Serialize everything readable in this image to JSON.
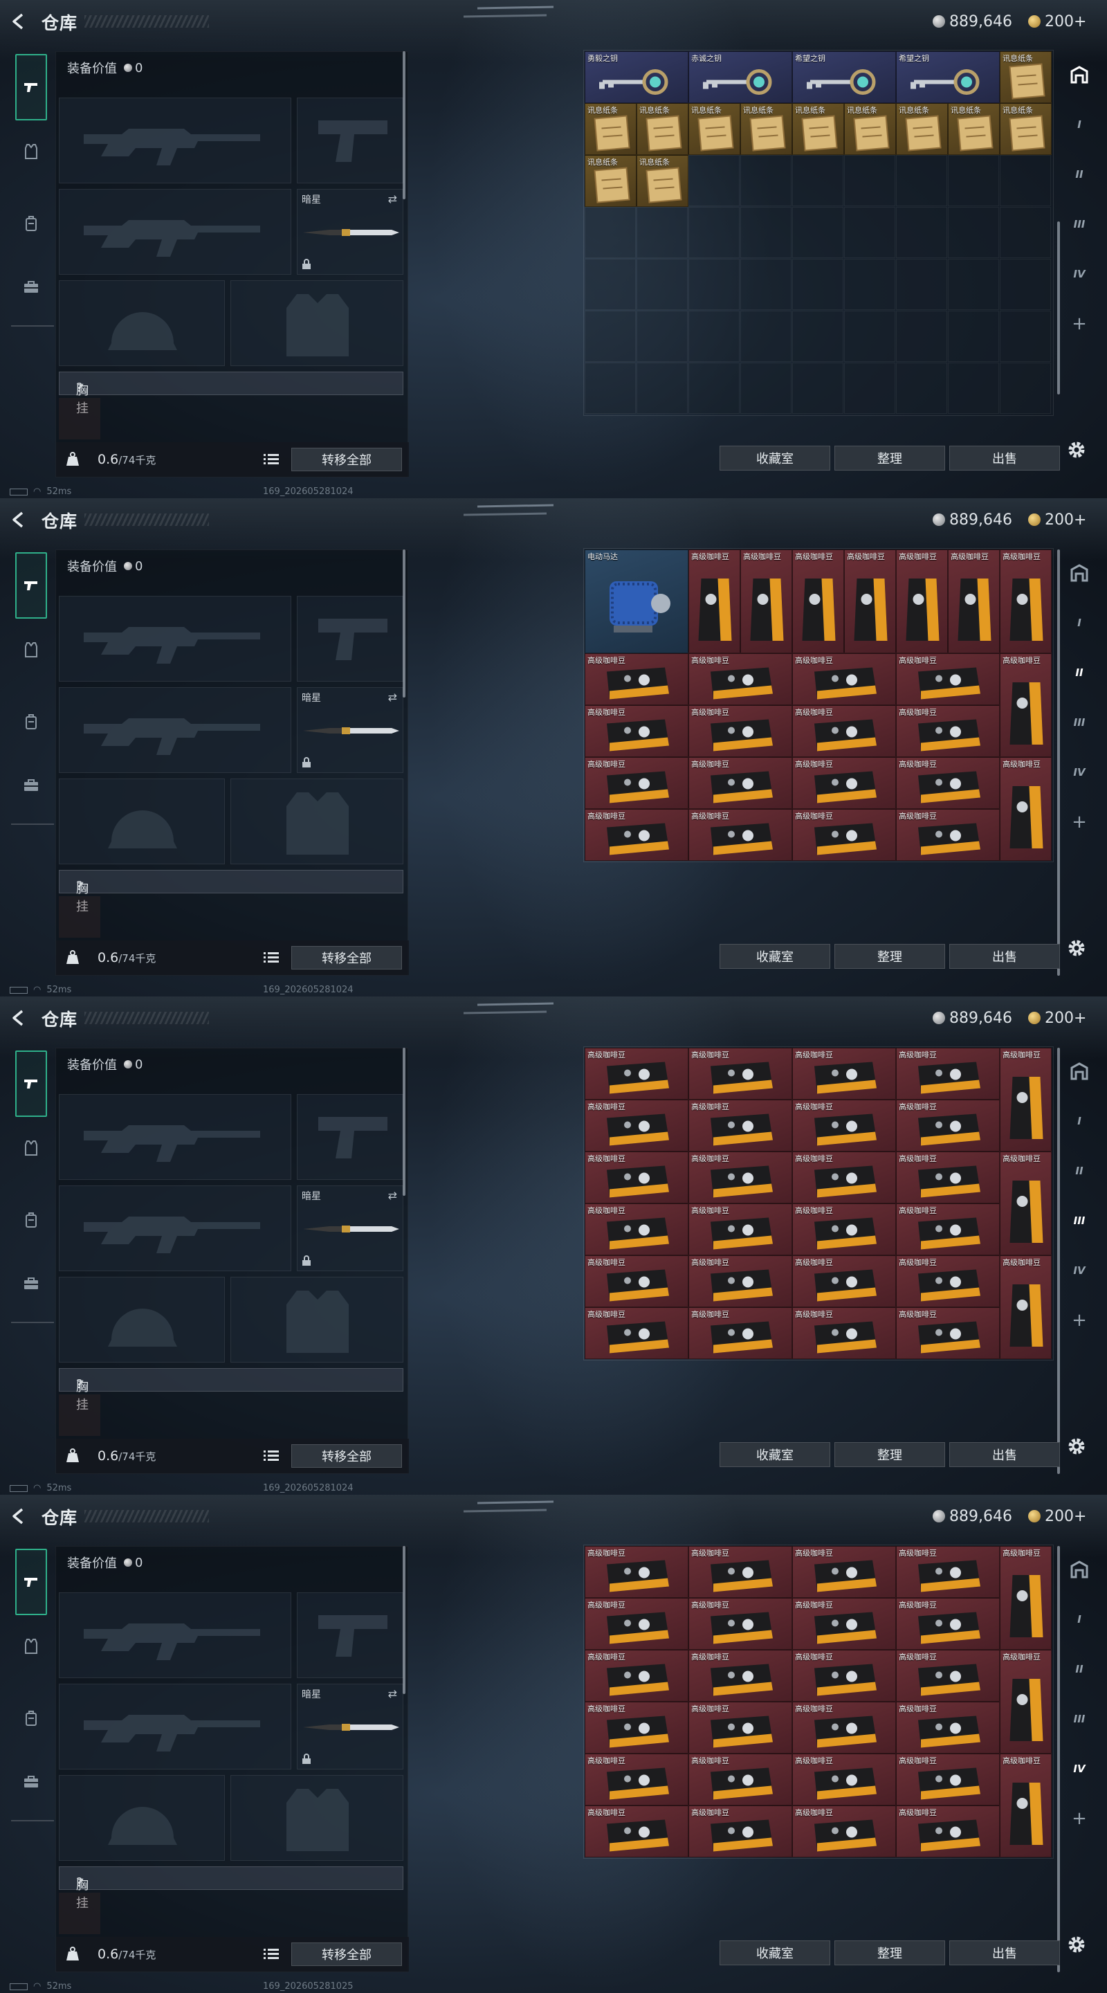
{
  "header": {
    "title": "仓库",
    "silver_amount": "889,646",
    "gold_amount": "200+"
  },
  "equipment": {
    "value_label": "装备价值",
    "value": "0",
    "secondary_name": "暗星",
    "chest_label": "胸挂",
    "chest_hint": "?",
    "weight_current": "0.6",
    "weight_max": "/74千克",
    "transfer_all": "转移全部"
  },
  "buttons": {
    "collection": "收藏室",
    "sort": "整理",
    "sell": "出售"
  },
  "status": {
    "ping": "52ms",
    "builds": [
      "169_202605281024",
      "169_202605281024",
      "169_202605281024",
      "169_202605281025"
    ]
  },
  "right_tabs": [
    "I",
    "II",
    "III",
    "IV",
    "+"
  ],
  "active_right_tab": [
    0,
    1,
    2,
    3
  ],
  "colors": {
    "accent_green": "#2fb08a",
    "rarity_red": "#5a2a31",
    "rarity_gold": "#5e4a22",
    "rarity_purple": "#2d3358"
  },
  "icons": [
    "back-arrow-icon",
    "silver-coin-icon",
    "gold-coin-icon",
    "rifle-icon",
    "vest-icon",
    "backpack-icon",
    "briefcase-icon",
    "lock-icon",
    "weight-icon",
    "list-icon",
    "gear-icon",
    "wifi-icon"
  ],
  "panels": [
    {
      "items": [
        {
          "name": "勇毅之钥",
          "r": 0,
          "c": 0,
          "w": 2,
          "h": 1,
          "rarity": "purple",
          "art": "key"
        },
        {
          "name": "赤诚之钥",
          "r": 0,
          "c": 2,
          "w": 2,
          "h": 1,
          "rarity": "purple",
          "art": "key"
        },
        {
          "name": "希望之钥",
          "r": 0,
          "c": 4,
          "w": 2,
          "h": 1,
          "rarity": "purple",
          "art": "key"
        },
        {
          "name": "希望之钥",
          "r": 0,
          "c": 6,
          "w": 2,
          "h": 1,
          "rarity": "purple",
          "art": "key"
        },
        {
          "name": "讯息纸条",
          "r": 0,
          "c": 8,
          "w": 1,
          "h": 1,
          "rarity": "gold",
          "art": "paper"
        },
        {
          "name": "讯息纸条",
          "r": 1,
          "c": 0,
          "w": 1,
          "h": 1,
          "rarity": "gold",
          "art": "paper"
        },
        {
          "name": "讯息纸条",
          "r": 1,
          "c": 1,
          "w": 1,
          "h": 1,
          "rarity": "gold",
          "art": "paper"
        },
        {
          "name": "讯息纸条",
          "r": 1,
          "c": 2,
          "w": 1,
          "h": 1,
          "rarity": "gold",
          "art": "paper"
        },
        {
          "name": "讯息纸条",
          "r": 1,
          "c": 3,
          "w": 1,
          "h": 1,
          "rarity": "gold",
          "art": "paper"
        },
        {
          "name": "讯息纸条",
          "r": 1,
          "c": 4,
          "w": 1,
          "h": 1,
          "rarity": "gold",
          "art": "paper"
        },
        {
          "name": "讯息纸条",
          "r": 1,
          "c": 5,
          "w": 1,
          "h": 1,
          "rarity": "gold",
          "art": "paper"
        },
        {
          "name": "讯息纸条",
          "r": 1,
          "c": 6,
          "w": 1,
          "h": 1,
          "rarity": "gold",
          "art": "paper"
        },
        {
          "name": "讯息纸条",
          "r": 1,
          "c": 7,
          "w": 1,
          "h": 1,
          "rarity": "gold",
          "art": "paper"
        },
        {
          "name": "讯息纸条",
          "r": 1,
          "c": 8,
          "w": 1,
          "h": 1,
          "rarity": "gold",
          "art": "paper"
        },
        {
          "name": "讯息纸条",
          "r": 2,
          "c": 0,
          "w": 1,
          "h": 1,
          "rarity": "gold",
          "art": "paper"
        },
        {
          "name": "讯息纸条",
          "r": 2,
          "c": 1,
          "w": 1,
          "h": 1,
          "rarity": "gold",
          "art": "paper"
        }
      ]
    },
    {
      "items": [
        {
          "name": "电动马达",
          "r": 0,
          "c": 0,
          "w": 2,
          "h": 2,
          "rarity": "blue",
          "art": "motor"
        },
        {
          "name": "高级咖啡豆",
          "r": 0,
          "c": 2,
          "w": 1,
          "h": 2,
          "rarity": "red",
          "art": "bag"
        },
        {
          "name": "高级咖啡豆",
          "r": 0,
          "c": 3,
          "w": 1,
          "h": 2,
          "rarity": "red",
          "art": "bag"
        },
        {
          "name": "高级咖啡豆",
          "r": 0,
          "c": 4,
          "w": 1,
          "h": 2,
          "rarity": "red",
          "art": "bag"
        },
        {
          "name": "高级咖啡豆",
          "r": 0,
          "c": 5,
          "w": 1,
          "h": 2,
          "rarity": "red",
          "art": "bag"
        },
        {
          "name": "高级咖啡豆",
          "r": 0,
          "c": 6,
          "w": 1,
          "h": 2,
          "rarity": "red",
          "art": "bag"
        },
        {
          "name": "高级咖啡豆",
          "r": 0,
          "c": 7,
          "w": 1,
          "h": 2,
          "rarity": "red",
          "art": "bag"
        },
        {
          "name": "高级咖啡豆",
          "r": 0,
          "c": 8,
          "w": 1,
          "h": 2,
          "rarity": "red",
          "art": "bag"
        },
        {
          "name": "高级咖啡豆",
          "r": 2,
          "c": 0,
          "w": 2,
          "h": 1,
          "rarity": "red",
          "art": "box"
        },
        {
          "name": "高级咖啡豆",
          "r": 2,
          "c": 2,
          "w": 2,
          "h": 1,
          "rarity": "red",
          "art": "box"
        },
        {
          "name": "高级咖啡豆",
          "r": 2,
          "c": 4,
          "w": 2,
          "h": 1,
          "rarity": "red",
          "art": "box"
        },
        {
          "name": "高级咖啡豆",
          "r": 2,
          "c": 6,
          "w": 2,
          "h": 1,
          "rarity": "red",
          "art": "box"
        },
        {
          "name": "高级咖啡豆",
          "r": 2,
          "c": 8,
          "w": 1,
          "h": 2,
          "rarity": "red",
          "art": "bag"
        },
        {
          "name": "高级咖啡豆",
          "r": 3,
          "c": 0,
          "w": 2,
          "h": 1,
          "rarity": "red",
          "art": "box"
        },
        {
          "name": "高级咖啡豆",
          "r": 3,
          "c": 2,
          "w": 2,
          "h": 1,
          "rarity": "red",
          "art": "box"
        },
        {
          "name": "高级咖啡豆",
          "r": 3,
          "c": 4,
          "w": 2,
          "h": 1,
          "rarity": "red",
          "art": "box"
        },
        {
          "name": "高级咖啡豆",
          "r": 3,
          "c": 6,
          "w": 2,
          "h": 1,
          "rarity": "red",
          "art": "box"
        },
        {
          "name": "高级咖啡豆",
          "r": 4,
          "c": 0,
          "w": 2,
          "h": 1,
          "rarity": "red",
          "art": "box"
        },
        {
          "name": "高级咖啡豆",
          "r": 4,
          "c": 2,
          "w": 2,
          "h": 1,
          "rarity": "red",
          "art": "box"
        },
        {
          "name": "高级咖啡豆",
          "r": 4,
          "c": 4,
          "w": 2,
          "h": 1,
          "rarity": "red",
          "art": "box"
        },
        {
          "name": "高级咖啡豆",
          "r": 4,
          "c": 6,
          "w": 2,
          "h": 1,
          "rarity": "red",
          "art": "box"
        },
        {
          "name": "高级咖啡豆",
          "r": 4,
          "c": 8,
          "w": 1,
          "h": 2,
          "rarity": "red",
          "art": "bag"
        },
        {
          "name": "高级咖啡豆",
          "r": 5,
          "c": 0,
          "w": 2,
          "h": 1,
          "rarity": "red",
          "art": "box"
        },
        {
          "name": "高级咖啡豆",
          "r": 5,
          "c": 2,
          "w": 2,
          "h": 1,
          "rarity": "red",
          "art": "box"
        },
        {
          "name": "高级咖啡豆",
          "r": 5,
          "c": 4,
          "w": 2,
          "h": 1,
          "rarity": "red",
          "art": "box"
        },
        {
          "name": "高级咖啡豆",
          "r": 5,
          "c": 6,
          "w": 2,
          "h": 1,
          "rarity": "red",
          "art": "box"
        }
      ]
    },
    {
      "items": [
        {
          "name": "高级咖啡豆",
          "r": 0,
          "c": 0,
          "w": 2,
          "h": 1,
          "rarity": "red",
          "art": "box"
        },
        {
          "name": "高级咖啡豆",
          "r": 0,
          "c": 2,
          "w": 2,
          "h": 1,
          "rarity": "red",
          "art": "box"
        },
        {
          "name": "高级咖啡豆",
          "r": 0,
          "c": 4,
          "w": 2,
          "h": 1,
          "rarity": "red",
          "art": "box"
        },
        {
          "name": "高级咖啡豆",
          "r": 0,
          "c": 6,
          "w": 2,
          "h": 1,
          "rarity": "red",
          "art": "box"
        },
        {
          "name": "高级咖啡豆",
          "r": 0,
          "c": 8,
          "w": 1,
          "h": 2,
          "rarity": "red",
          "art": "bag"
        },
        {
          "name": "高级咖啡豆",
          "r": 1,
          "c": 0,
          "w": 2,
          "h": 1,
          "rarity": "red",
          "art": "box"
        },
        {
          "name": "高级咖啡豆",
          "r": 1,
          "c": 2,
          "w": 2,
          "h": 1,
          "rarity": "red",
          "art": "box"
        },
        {
          "name": "高级咖啡豆",
          "r": 1,
          "c": 4,
          "w": 2,
          "h": 1,
          "rarity": "red",
          "art": "box"
        },
        {
          "name": "高级咖啡豆",
          "r": 1,
          "c": 6,
          "w": 2,
          "h": 1,
          "rarity": "red",
          "art": "box"
        },
        {
          "name": "高级咖啡豆",
          "r": 2,
          "c": 0,
          "w": 2,
          "h": 1,
          "rarity": "red",
          "art": "box"
        },
        {
          "name": "高级咖啡豆",
          "r": 2,
          "c": 2,
          "w": 2,
          "h": 1,
          "rarity": "red",
          "art": "box"
        },
        {
          "name": "高级咖啡豆",
          "r": 2,
          "c": 4,
          "w": 2,
          "h": 1,
          "rarity": "red",
          "art": "box"
        },
        {
          "name": "高级咖啡豆",
          "r": 2,
          "c": 6,
          "w": 2,
          "h": 1,
          "rarity": "red",
          "art": "box"
        },
        {
          "name": "高级咖啡豆",
          "r": 2,
          "c": 8,
          "w": 1,
          "h": 2,
          "rarity": "red",
          "art": "bag"
        },
        {
          "name": "高级咖啡豆",
          "r": 3,
          "c": 0,
          "w": 2,
          "h": 1,
          "rarity": "red",
          "art": "box"
        },
        {
          "name": "高级咖啡豆",
          "r": 3,
          "c": 2,
          "w": 2,
          "h": 1,
          "rarity": "red",
          "art": "box"
        },
        {
          "name": "高级咖啡豆",
          "r": 3,
          "c": 4,
          "w": 2,
          "h": 1,
          "rarity": "red",
          "art": "box"
        },
        {
          "name": "高级咖啡豆",
          "r": 3,
          "c": 6,
          "w": 2,
          "h": 1,
          "rarity": "red",
          "art": "box"
        },
        {
          "name": "高级咖啡豆",
          "r": 4,
          "c": 0,
          "w": 2,
          "h": 1,
          "rarity": "red",
          "art": "box"
        },
        {
          "name": "高级咖啡豆",
          "r": 4,
          "c": 2,
          "w": 2,
          "h": 1,
          "rarity": "red",
          "art": "box"
        },
        {
          "name": "高级咖啡豆",
          "r": 4,
          "c": 4,
          "w": 2,
          "h": 1,
          "rarity": "red",
          "art": "box"
        },
        {
          "name": "高级咖啡豆",
          "r": 4,
          "c": 6,
          "w": 2,
          "h": 1,
          "rarity": "red",
          "art": "box"
        },
        {
          "name": "高级咖啡豆",
          "r": 4,
          "c": 8,
          "w": 1,
          "h": 2,
          "rarity": "red",
          "art": "bag"
        },
        {
          "name": "高级咖啡豆",
          "r": 5,
          "c": 0,
          "w": 2,
          "h": 1,
          "rarity": "red",
          "art": "box"
        },
        {
          "name": "高级咖啡豆",
          "r": 5,
          "c": 2,
          "w": 2,
          "h": 1,
          "rarity": "red",
          "art": "box"
        },
        {
          "name": "高级咖啡豆",
          "r": 5,
          "c": 4,
          "w": 2,
          "h": 1,
          "rarity": "red",
          "art": "box"
        },
        {
          "name": "高级咖啡豆",
          "r": 5,
          "c": 6,
          "w": 2,
          "h": 1,
          "rarity": "red",
          "art": "box"
        }
      ]
    },
    {
      "items": [
        {
          "name": "高级咖啡豆",
          "r": 0,
          "c": 0,
          "w": 2,
          "h": 1,
          "rarity": "red",
          "art": "box"
        },
        {
          "name": "高级咖啡豆",
          "r": 0,
          "c": 2,
          "w": 2,
          "h": 1,
          "rarity": "red",
          "art": "box"
        },
        {
          "name": "高级咖啡豆",
          "r": 0,
          "c": 4,
          "w": 2,
          "h": 1,
          "rarity": "red",
          "art": "box"
        },
        {
          "name": "高级咖啡豆",
          "r": 0,
          "c": 6,
          "w": 2,
          "h": 1,
          "rarity": "red",
          "art": "box"
        },
        {
          "name": "高级咖啡豆",
          "r": 0,
          "c": 8,
          "w": 1,
          "h": 2,
          "rarity": "red",
          "art": "bag"
        },
        {
          "name": "高级咖啡豆",
          "r": 1,
          "c": 0,
          "w": 2,
          "h": 1,
          "rarity": "red",
          "art": "box"
        },
        {
          "name": "高级咖啡豆",
          "r": 1,
          "c": 2,
          "w": 2,
          "h": 1,
          "rarity": "red",
          "art": "box"
        },
        {
          "name": "高级咖啡豆",
          "r": 1,
          "c": 4,
          "w": 2,
          "h": 1,
          "rarity": "red",
          "art": "box"
        },
        {
          "name": "高级咖啡豆",
          "r": 1,
          "c": 6,
          "w": 2,
          "h": 1,
          "rarity": "red",
          "art": "box"
        },
        {
          "name": "高级咖啡豆",
          "r": 2,
          "c": 0,
          "w": 2,
          "h": 1,
          "rarity": "red",
          "art": "box"
        },
        {
          "name": "高级咖啡豆",
          "r": 2,
          "c": 2,
          "w": 2,
          "h": 1,
          "rarity": "red",
          "art": "box"
        },
        {
          "name": "高级咖啡豆",
          "r": 2,
          "c": 4,
          "w": 2,
          "h": 1,
          "rarity": "red",
          "art": "box"
        },
        {
          "name": "高级咖啡豆",
          "r": 2,
          "c": 6,
          "w": 2,
          "h": 1,
          "rarity": "red",
          "art": "box"
        },
        {
          "name": "高级咖啡豆",
          "r": 2,
          "c": 8,
          "w": 1,
          "h": 2,
          "rarity": "red",
          "art": "bag"
        },
        {
          "name": "高级咖啡豆",
          "r": 3,
          "c": 0,
          "w": 2,
          "h": 1,
          "rarity": "red",
          "art": "box"
        },
        {
          "name": "高级咖啡豆",
          "r": 3,
          "c": 2,
          "w": 2,
          "h": 1,
          "rarity": "red",
          "art": "box"
        },
        {
          "name": "高级咖啡豆",
          "r": 3,
          "c": 4,
          "w": 2,
          "h": 1,
          "rarity": "red",
          "art": "box"
        },
        {
          "name": "高级咖啡豆",
          "r": 3,
          "c": 6,
          "w": 2,
          "h": 1,
          "rarity": "red",
          "art": "box"
        },
        {
          "name": "高级咖啡豆",
          "r": 4,
          "c": 0,
          "w": 2,
          "h": 1,
          "rarity": "red",
          "art": "box"
        },
        {
          "name": "高级咖啡豆",
          "r": 4,
          "c": 2,
          "w": 2,
          "h": 1,
          "rarity": "red",
          "art": "box"
        },
        {
          "name": "高级咖啡豆",
          "r": 4,
          "c": 4,
          "w": 2,
          "h": 1,
          "rarity": "red",
          "art": "box"
        },
        {
          "name": "高级咖啡豆",
          "r": 4,
          "c": 6,
          "w": 2,
          "h": 1,
          "rarity": "red",
          "art": "box"
        },
        {
          "name": "高级咖啡豆",
          "r": 4,
          "c": 8,
          "w": 1,
          "h": 2,
          "rarity": "red",
          "art": "bag"
        },
        {
          "name": "高级咖啡豆",
          "r": 5,
          "c": 0,
          "w": 2,
          "h": 1,
          "rarity": "red",
          "art": "box"
        },
        {
          "name": "高级咖啡豆",
          "r": 5,
          "c": 2,
          "w": 2,
          "h": 1,
          "rarity": "red",
          "art": "box"
        },
        {
          "name": "高级咖啡豆",
          "r": 5,
          "c": 4,
          "w": 2,
          "h": 1,
          "rarity": "red",
          "art": "box"
        },
        {
          "name": "高级咖啡豆",
          "r": 5,
          "c": 6,
          "w": 2,
          "h": 1,
          "rarity": "red",
          "art": "box"
        }
      ]
    }
  ]
}
